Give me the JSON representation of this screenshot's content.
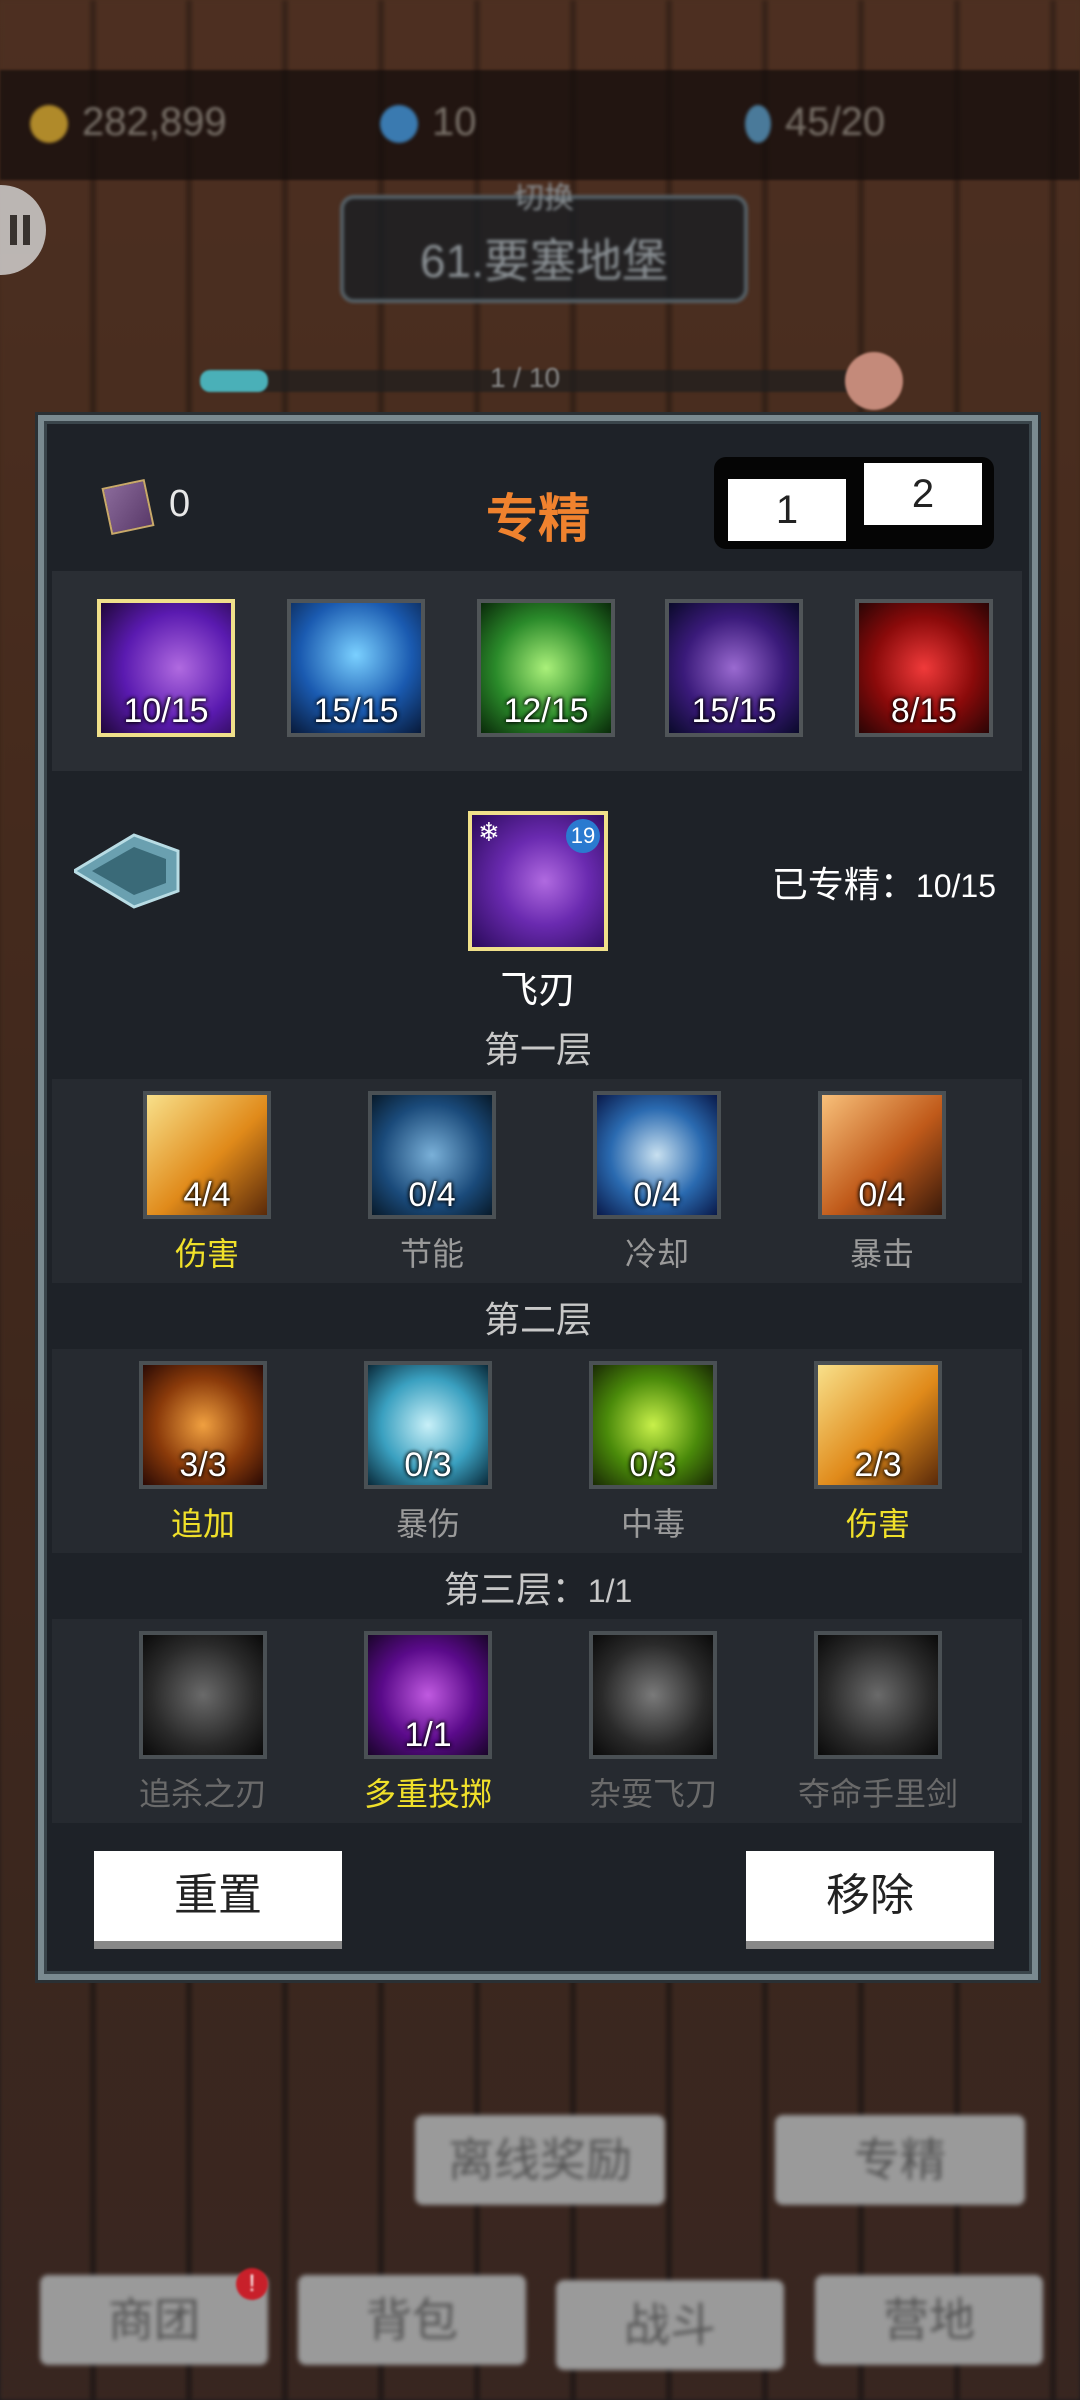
{
  "top_bar": {
    "gold": "282,899",
    "gems": "10",
    "energy": "45/20"
  },
  "stage": {
    "switch_label": "切换",
    "name": "61.要塞地堡",
    "progress": "1 / 10",
    "progress_fraction": 0.1
  },
  "panel": {
    "title": "专精",
    "book_count": "0",
    "tabs": [
      "1",
      "2"
    ],
    "skills": [
      {
        "count": "10/15",
        "icon": "purple-blades-icon",
        "selected": true
      },
      {
        "count": "15/15",
        "icon": "blue-spirit-icon",
        "selected": false
      },
      {
        "count": "12/15",
        "icon": "green-bow-icon",
        "selected": false
      },
      {
        "count": "15/15",
        "icon": "shadow-figure-icon",
        "selected": false
      },
      {
        "count": "8/15",
        "icon": "red-target-icon",
        "selected": false
      }
    ],
    "current": {
      "name": "飞刃",
      "level": "19",
      "mastered_label": "已专精：",
      "mastered_value": "10/15"
    },
    "layer1": {
      "title": "第一层",
      "talents": [
        {
          "count": "4/4",
          "name": "伤害",
          "active": true
        },
        {
          "count": "0/4",
          "name": "节能",
          "active": false
        },
        {
          "count": "0/4",
          "name": "冷却",
          "active": false
        },
        {
          "count": "0/4",
          "name": "暴击",
          "active": false
        }
      ]
    },
    "layer2": {
      "title": "第二层",
      "talents": [
        {
          "count": "3/3",
          "name": "追加",
          "active": true
        },
        {
          "count": "0/3",
          "name": "暴伤",
          "active": false
        },
        {
          "count": "0/3",
          "name": "中毒",
          "active": false
        },
        {
          "count": "2/3",
          "name": "伤害",
          "active": true
        }
      ]
    },
    "layer3": {
      "title": "第三层：",
      "value": "1/1",
      "talents": [
        {
          "count": "",
          "name": "追杀之刃",
          "active": false
        },
        {
          "count": "1/1",
          "name": "多重投掷",
          "active": true
        },
        {
          "count": "",
          "name": "杂耍飞刀",
          "active": false
        },
        {
          "count": "",
          "name": "夺命手里剑",
          "active": false
        }
      ]
    },
    "reset_label": "重置",
    "remove_label": "移除"
  },
  "bottom": {
    "offline_reward": "离线奖励",
    "mastery": "专精",
    "nav": [
      "商团",
      "背包",
      "战斗",
      "营地"
    ],
    "badge": "!"
  },
  "colors": {
    "title": "#f0822e",
    "active_text": "#f0e02a",
    "selected_border": "#f0e08a"
  }
}
